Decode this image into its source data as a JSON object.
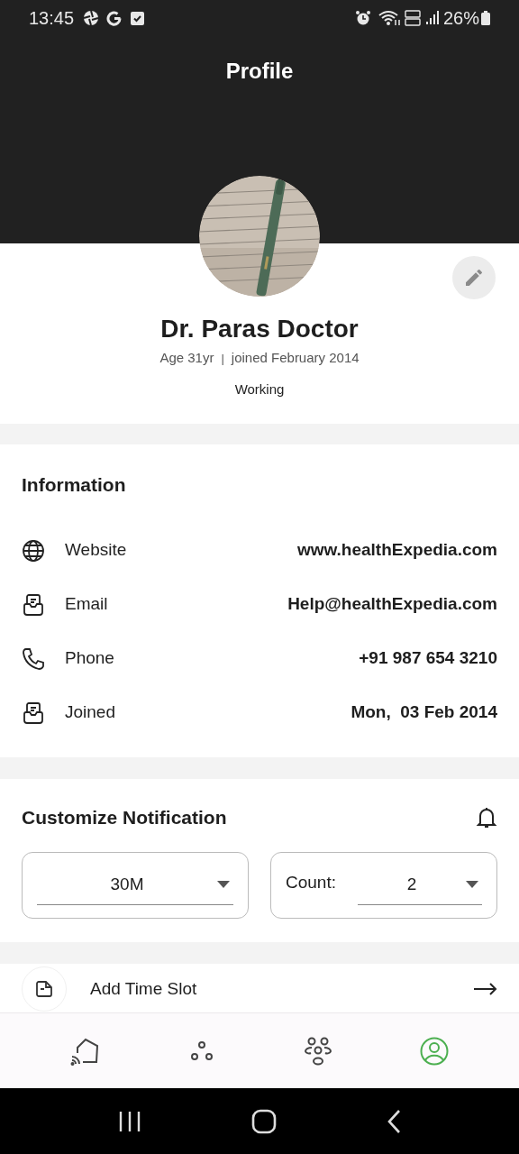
{
  "status_bar": {
    "time": "13:45",
    "battery": "26%"
  },
  "header": {
    "title": "Profile"
  },
  "profile": {
    "name": "Dr. Paras Doctor",
    "age": "Age 31yr",
    "joined": "joined February 2014",
    "separator": "|",
    "status": "Working"
  },
  "information": {
    "title": "Information",
    "rows": [
      {
        "kind": "globe",
        "label": "Website",
        "value": "www.healthExpedia.com"
      },
      {
        "kind": "inbox",
        "label": "Email",
        "value": "Help@healthExpedia.com"
      },
      {
        "kind": "phone",
        "label": "Phone",
        "value": "+91 987 654 3210"
      },
      {
        "kind": "inbox",
        "label": "Joined",
        "value": "Mon,  03 Feb 2014"
      }
    ]
  },
  "notification": {
    "title": "Customize Notification",
    "dropdowns": [
      {
        "value": "30M"
      },
      {
        "label": "Count:",
        "value": "2"
      }
    ]
  },
  "actions": [
    {
      "label": "Add Time Slot"
    }
  ],
  "bottom_nav": [
    {
      "kind": "home",
      "selected": false
    },
    {
      "kind": "dots",
      "selected": false
    },
    {
      "kind": "group",
      "selected": false
    },
    {
      "kind": "profile",
      "selected": true
    }
  ]
}
